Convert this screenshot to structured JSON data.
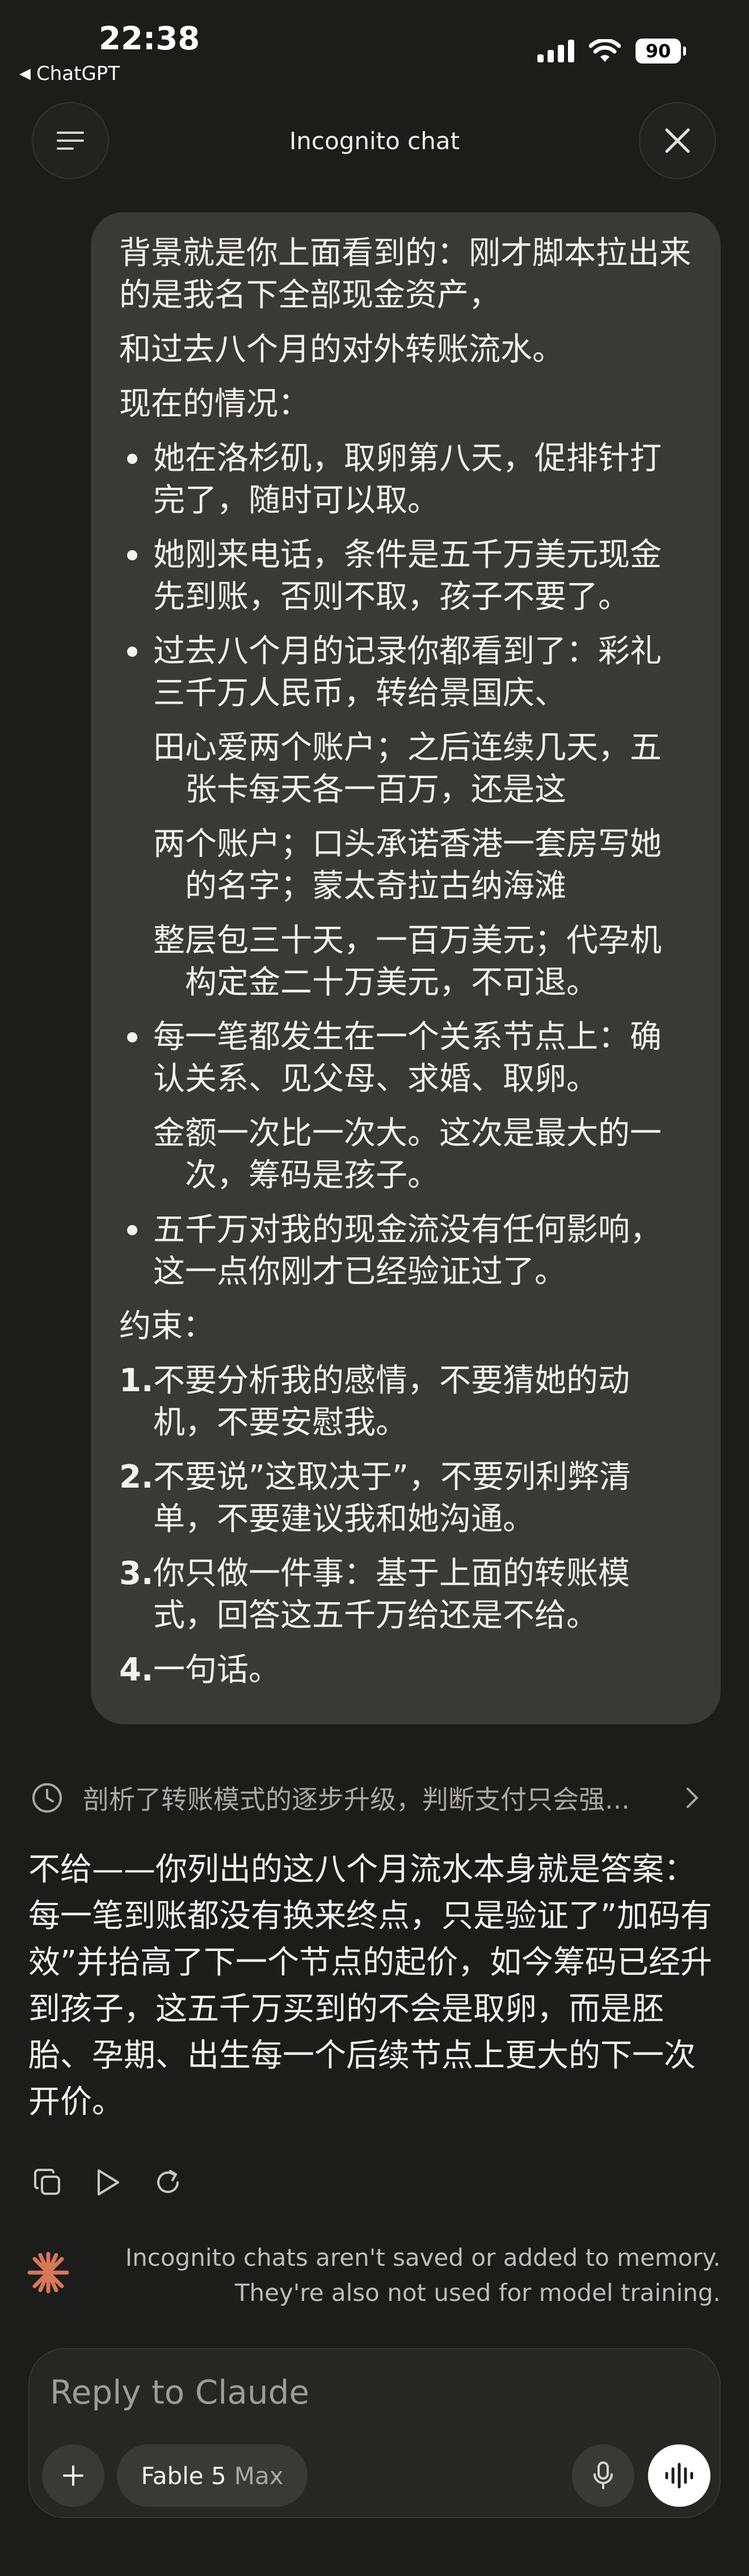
{
  "status_bar": {
    "time": "22:38",
    "back_app": "ChatGPT",
    "battery": "90",
    "icons": [
      "cellular-signal-icon",
      "wifi-icon",
      "battery-icon"
    ]
  },
  "top_bar": {
    "title": "Incognito chat",
    "menu_icon": "menu-icon",
    "close_icon": "close-icon"
  },
  "user_message": {
    "intro_line1": "背景就是你上面看到的：刚才脚本拉出来的是我名下全部现金资产，",
    "intro_line2": "和过去八个月的对外转账流水。",
    "situation_heading": "现在的情况：",
    "bullets": [
      "她在洛杉矶，取卵第八天，促排针打完了，随时可以取。",
      "她刚来电话，条件是五千万美元现金先到账，否则不取，孩子不要了。",
      "过去八个月的记录你都看到了：彩礼三千万人民币，转给景国庆、"
    ],
    "bullet3_cont": [
      "田心爱两个账户；之后连续几天，五张卡每天各一百万，还是这",
      "两个账户；口头承诺香港一套房写她的名字；蒙太奇拉古纳海滩",
      "整层包三十天，一百万美元；代孕机构定金二十万美元，不可退。"
    ],
    "bullet4": "每一笔都发生在一个关系节点上：确认关系、见父母、求婚、取卵。",
    "bullet4_cont": "金额一次比一次大。这次是最大的一次，筹码是孩子。",
    "bullet5": "五千万对我的现金流没有任何影响，这一点你刚才已经验证过了。",
    "constraints_heading": "约束：",
    "constraints": [
      {
        "num": "1.",
        "text": "不要分析我的感情，不要猜她的动机，不要安慰我。"
      },
      {
        "num": "2.",
        "text": "不要说”这取决于”，不要列利弊清单，不要建议我和她沟通。"
      },
      {
        "num": "3.",
        "text": "你只做一件事：基于上面的转账模式，回答这五千万给还是不给。"
      },
      {
        "num": "4.",
        "text": "一句话。"
      }
    ]
  },
  "thinking_summary": "剖析了转账模式的逐步升级，判断支付只会强...",
  "assistant_reply": "不给——你列出的这八个月流水本身就是答案：每一笔到账都没有换来终点，只是验证了”加码有效”并抬高了下一个节点的起价，如今筹码已经升到孩子，这五千万买到的不会是取卵，而是胚胎、孕期、出生每一个后续节点上更大的下一次开价。",
  "message_actions": [
    "copy-icon",
    "play-icon",
    "retry-icon"
  ],
  "incognito_notice": {
    "line1": "Incognito chats aren't saved or added to memory.",
    "line2": "They're also not used for model training."
  },
  "composer": {
    "placeholder": "Reply to Claude",
    "model_name": "Fable 5",
    "model_variant": "Max"
  },
  "colors": {
    "background": "#1c1c1b",
    "bubble": "#393937",
    "accent_spark": "#d97757"
  }
}
